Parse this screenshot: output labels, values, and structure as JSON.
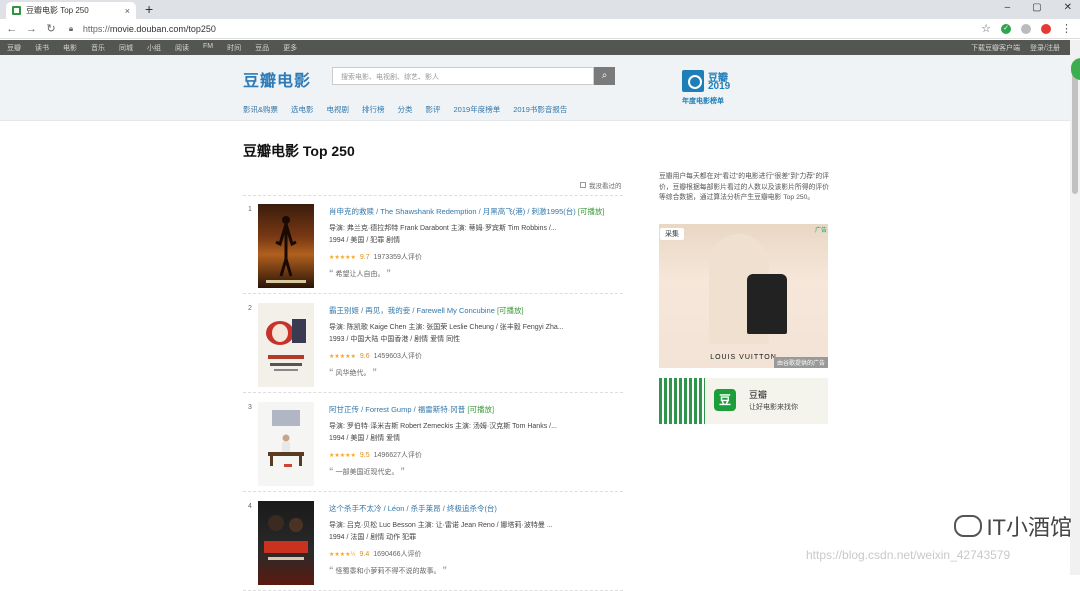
{
  "browser": {
    "tab_title": "豆瓣电影 Top 250",
    "tab_close": "×",
    "new_tab": "+",
    "win_minimize": "–",
    "win_restore": "▢",
    "win_close": "✕",
    "url_scheme": "https://",
    "url_rest": "movie.douban.com/top250"
  },
  "global_nav": {
    "items": [
      "豆瓣",
      "读书",
      "电影",
      "音乐",
      "同城",
      "小组",
      "阅读",
      "FM",
      "时间",
      "豆品",
      "更多"
    ],
    "right": [
      "下载豆瓣客户端",
      "登录/注册"
    ]
  },
  "header": {
    "logo": "豆瓣电影",
    "search_placeholder": "搜索电影、电视剧、综艺、影人",
    "subnav": [
      "影讯&购票",
      "选电影",
      "电视剧",
      "排行榜",
      "分类",
      "影评",
      "2019年度榜单",
      "2019书影音报告"
    ],
    "annual_brand": "豆瓣",
    "annual_year": "2019",
    "annual_label": "年度电影榜单"
  },
  "main": {
    "page_title": "豆瓣电影 Top 250",
    "hide_watched": "我没看过的",
    "movies": [
      {
        "rank": "1",
        "title": "肖申克的救赎 / The Shawshank Redemption / 月黑高飞(港) / 刺激1995(台)",
        "title_cn": "肖申克的救赎",
        "title_rest": " / The Shawshank Redemption / 月黑高飞(港) / 刺激1995(台)",
        "playable": "[可播放]",
        "credits": "导演: 弗兰克·德拉邦特 Frank Darabont   主演: 蒂姆·罗宾斯 Tim Robbins /...",
        "meta": "1994 / 美国 / 犯罪 剧情",
        "stars": "★★★★★",
        "score": "9.7",
        "votes": "1973359人评价",
        "quote": "希望让人自由。"
      },
      {
        "rank": "2",
        "title_cn": "霸王别姬",
        "title_rest": " / 再见，我的妾 / Farewell My Concubine",
        "playable": "[可播放]",
        "credits": "导演: 陈凯歌 Kaige Chen   主演: 张国荣 Leslie Cheung / 张丰毅 Fengyi Zha...",
        "meta": "1993 / 中国大陆 中国香港 / 剧情 爱情 同性",
        "stars": "★★★★★",
        "score": "9.6",
        "votes": "1459603人评价",
        "quote": "风华绝代。"
      },
      {
        "rank": "3",
        "title_cn": "阿甘正传",
        "title_rest": " / Forrest Gump / 福雷斯特·冈普",
        "playable": "[可播放]",
        "credits": "导演: 罗伯特·泽米吉斯 Robert Zemeckis   主演: 汤姆·汉克斯 Tom Hanks /...",
        "meta": "1994 / 美国 / 剧情 爱情",
        "stars": "★★★★★",
        "score": "9.5",
        "votes": "1496627人评价",
        "quote": "一部美国近现代史。"
      },
      {
        "rank": "4",
        "title_cn": "这个杀手不太冷",
        "title_rest": " / Léon / 杀手莱昂 / 终极追杀令(台)",
        "playable": "",
        "credits": "导演: 吕克·贝松 Luc Besson   主演: 让·雷诺 Jean Reno / 娜塔莉·波特曼 ...",
        "meta": "1994 / 法国 / 剧情 动作 犯罪",
        "stars": "★★★★½",
        "score": "9.4",
        "votes": "1690466人评价",
        "quote": "怪蜀黍和小萝莉不得不说的故事。"
      }
    ]
  },
  "sidebar": {
    "description": "豆瓣用户每天都在对“看过”的电影进行“很差”到“力荐”的评价，豆瓣根据每部影片看过的人数以及该影片所得的评价等综合数据，通过算法分析产生豆瓣电影 Top 250。",
    "ad_collect": "采集",
    "ad_tag": "广告",
    "ad_brand": "LOUIS VUITTON",
    "ad_footer": "由谷歌提供的广告",
    "app_icon": "豆",
    "app_name": "豆瓣",
    "app_slogan": "让好电影来找你"
  },
  "watermarks": {
    "wechat": "IT小酒馆",
    "csdn": "https://blog.csdn.net/weixin_42743579"
  },
  "colors": {
    "link": "#3377aa",
    "playable": "#3a9a3a",
    "star": "#f5a623",
    "global_nav_bg": "#545652",
    "header_bg": "#f0f3f5"
  }
}
